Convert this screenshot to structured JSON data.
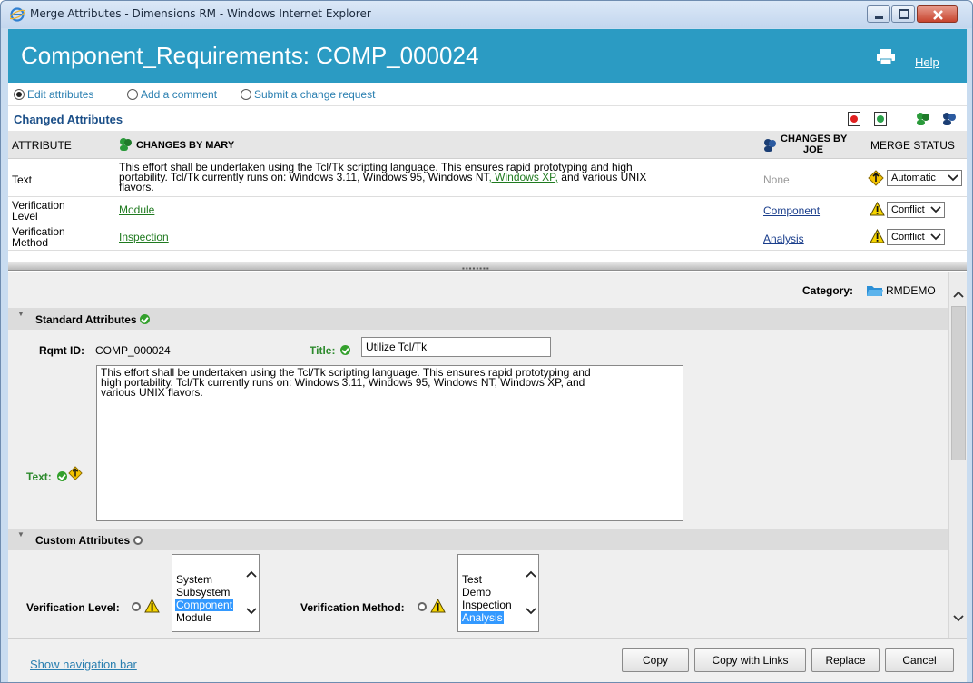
{
  "window": {
    "title": "Merge Attributes - Dimensions RM - Windows Internet Explorer"
  },
  "header": {
    "title": "Component_Requirements: COMP_000024",
    "help": "Help"
  },
  "modes": [
    {
      "label": "Edit attributes",
      "selected": true
    },
    {
      "label": "Add a comment",
      "selected": false
    },
    {
      "label": "Submit a change request",
      "selected": false
    }
  ],
  "changed": {
    "title": "Changed Attributes",
    "columns": {
      "attribute": "ATTRIBUTE",
      "mary": "CHANGES BY MARY",
      "joe_line1": "CHANGES BY",
      "joe_line2": "JOE",
      "merge": "MERGE STATUS"
    },
    "rows": [
      {
        "attribute": "Text",
        "mary_line1": "This effort shall be undertaken using the Tcl/Tk scripting language. This ensures rapid prototyping and high",
        "mary_line2_a": "portability. Tcl/Tk currently runs on: Windows 3.11, Windows 95, Windows NT",
        "mary_line2_link": ", Windows XP,",
        "mary_line2_b": " and various UNIX",
        "mary_line3": "flavors.",
        "joe": "None",
        "merge": "Automatic"
      },
      {
        "attribute_line1": "Verification",
        "attribute_line2": "Level",
        "mary": "Module",
        "joe": "Component",
        "merge": "Conflict"
      },
      {
        "attribute_line1": "Verification",
        "attribute_line2": "Method",
        "mary": "Inspection",
        "joe": "Analysis",
        "merge": "Conflict"
      }
    ]
  },
  "detail": {
    "category_label": "Category:",
    "category_value": "RMDEMO",
    "standard": {
      "title": "Standard Attributes",
      "rqmt_label": "Rqmt ID:",
      "rqmt_value": "COMP_000024",
      "title_label": "Title:",
      "title_value": "Utilize Tcl/Tk",
      "text_label": "Text:",
      "text_line1": "This effort shall be undertaken using the Tcl/Tk scripting language. This ensures rapid prototyping and",
      "text_line2": "high portability. Tcl/Tk currently runs on: Windows 3.11, Windows 95, Windows NT, Windows XP, and",
      "text_line3": "various UNIX flavors."
    },
    "custom": {
      "title": "Custom Attributes",
      "level_label": "Verification Level:",
      "level_options": [
        "System",
        "Subsystem",
        "Component",
        "Module"
      ],
      "level_selected": "Component",
      "method_label": "Verification Method:",
      "method_options": [
        "Test",
        "Demo",
        "Inspection",
        "Analysis"
      ],
      "method_selected": "Analysis"
    }
  },
  "footer": {
    "nav_link": "Show navigation bar",
    "buttons": [
      "Copy",
      "Copy with Links",
      "Replace",
      "Cancel"
    ]
  },
  "colors": {
    "header_bg": "#2b9bc3",
    "link_green": "#1f7a1f",
    "link_blue": "#1a3e8c",
    "selection": "#3399ff"
  }
}
